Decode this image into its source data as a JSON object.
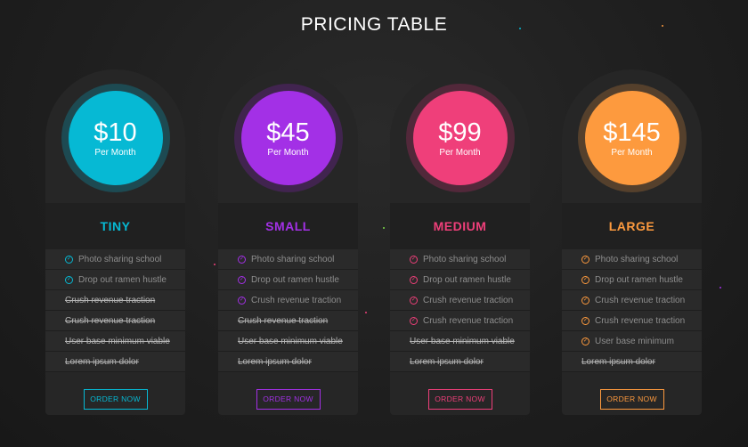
{
  "title": "PRICING TABLE",
  "plans": [
    {
      "price": "$10",
      "period": "Per Month",
      "name": "TINY",
      "button": "ORDER NOW",
      "color": "#06b9d4",
      "ring": "#1d4a52",
      "features": [
        {
          "text": "Photo sharing school",
          "included": true
        },
        {
          "text": "Drop out ramen hustle",
          "included": true
        },
        {
          "text": "Crush revenue traction",
          "included": false
        },
        {
          "text": "Crush revenue traction",
          "included": false
        },
        {
          "text": "User base minimum viable",
          "included": false
        },
        {
          "text": "Lorem ipsum dolor",
          "included": false
        }
      ]
    },
    {
      "price": "$45",
      "period": "Per Month",
      "name": "SMALL",
      "button": "ORDER NOW",
      "color": "#a330e6",
      "ring": "#41244f",
      "features": [
        {
          "text": "Photo sharing school",
          "included": true
        },
        {
          "text": "Drop out ramen hustle",
          "included": true
        },
        {
          "text": "Crush revenue traction",
          "included": true
        },
        {
          "text": "Crush revenue traction",
          "included": false
        },
        {
          "text": "User base minimum viable",
          "included": false
        },
        {
          "text": "Lorem ipsum dolor",
          "included": false
        }
      ]
    },
    {
      "price": "$99",
      "period": "Per Month",
      "name": "MEDIUM",
      "button": "ORDER NOW",
      "color": "#ef3f7a",
      "ring": "#52283a",
      "features": [
        {
          "text": "Photo sharing school",
          "included": true
        },
        {
          "text": "Drop out ramen hustle",
          "included": true
        },
        {
          "text": "Crush revenue traction",
          "included": true
        },
        {
          "text": "Crush revenue traction",
          "included": true
        },
        {
          "text": "User base minimum viable",
          "included": false
        },
        {
          "text": "Lorem ipsum dolor",
          "included": false
        }
      ]
    },
    {
      "price": "$145",
      "period": "Per Month",
      "name": "LARGE",
      "button": "ORDER NOW",
      "color": "#fd9a3e",
      "ring": "#55402c",
      "features": [
        {
          "text": "Photo sharing school",
          "included": true
        },
        {
          "text": "Drop out ramen hustle",
          "included": true
        },
        {
          "text": "Crush revenue traction",
          "included": true
        },
        {
          "text": "Crush revenue traction",
          "included": true
        },
        {
          "text": "User base minimum",
          "included": true
        },
        {
          "text": "Lorem ipsum dolor",
          "included": false
        }
      ]
    }
  ]
}
